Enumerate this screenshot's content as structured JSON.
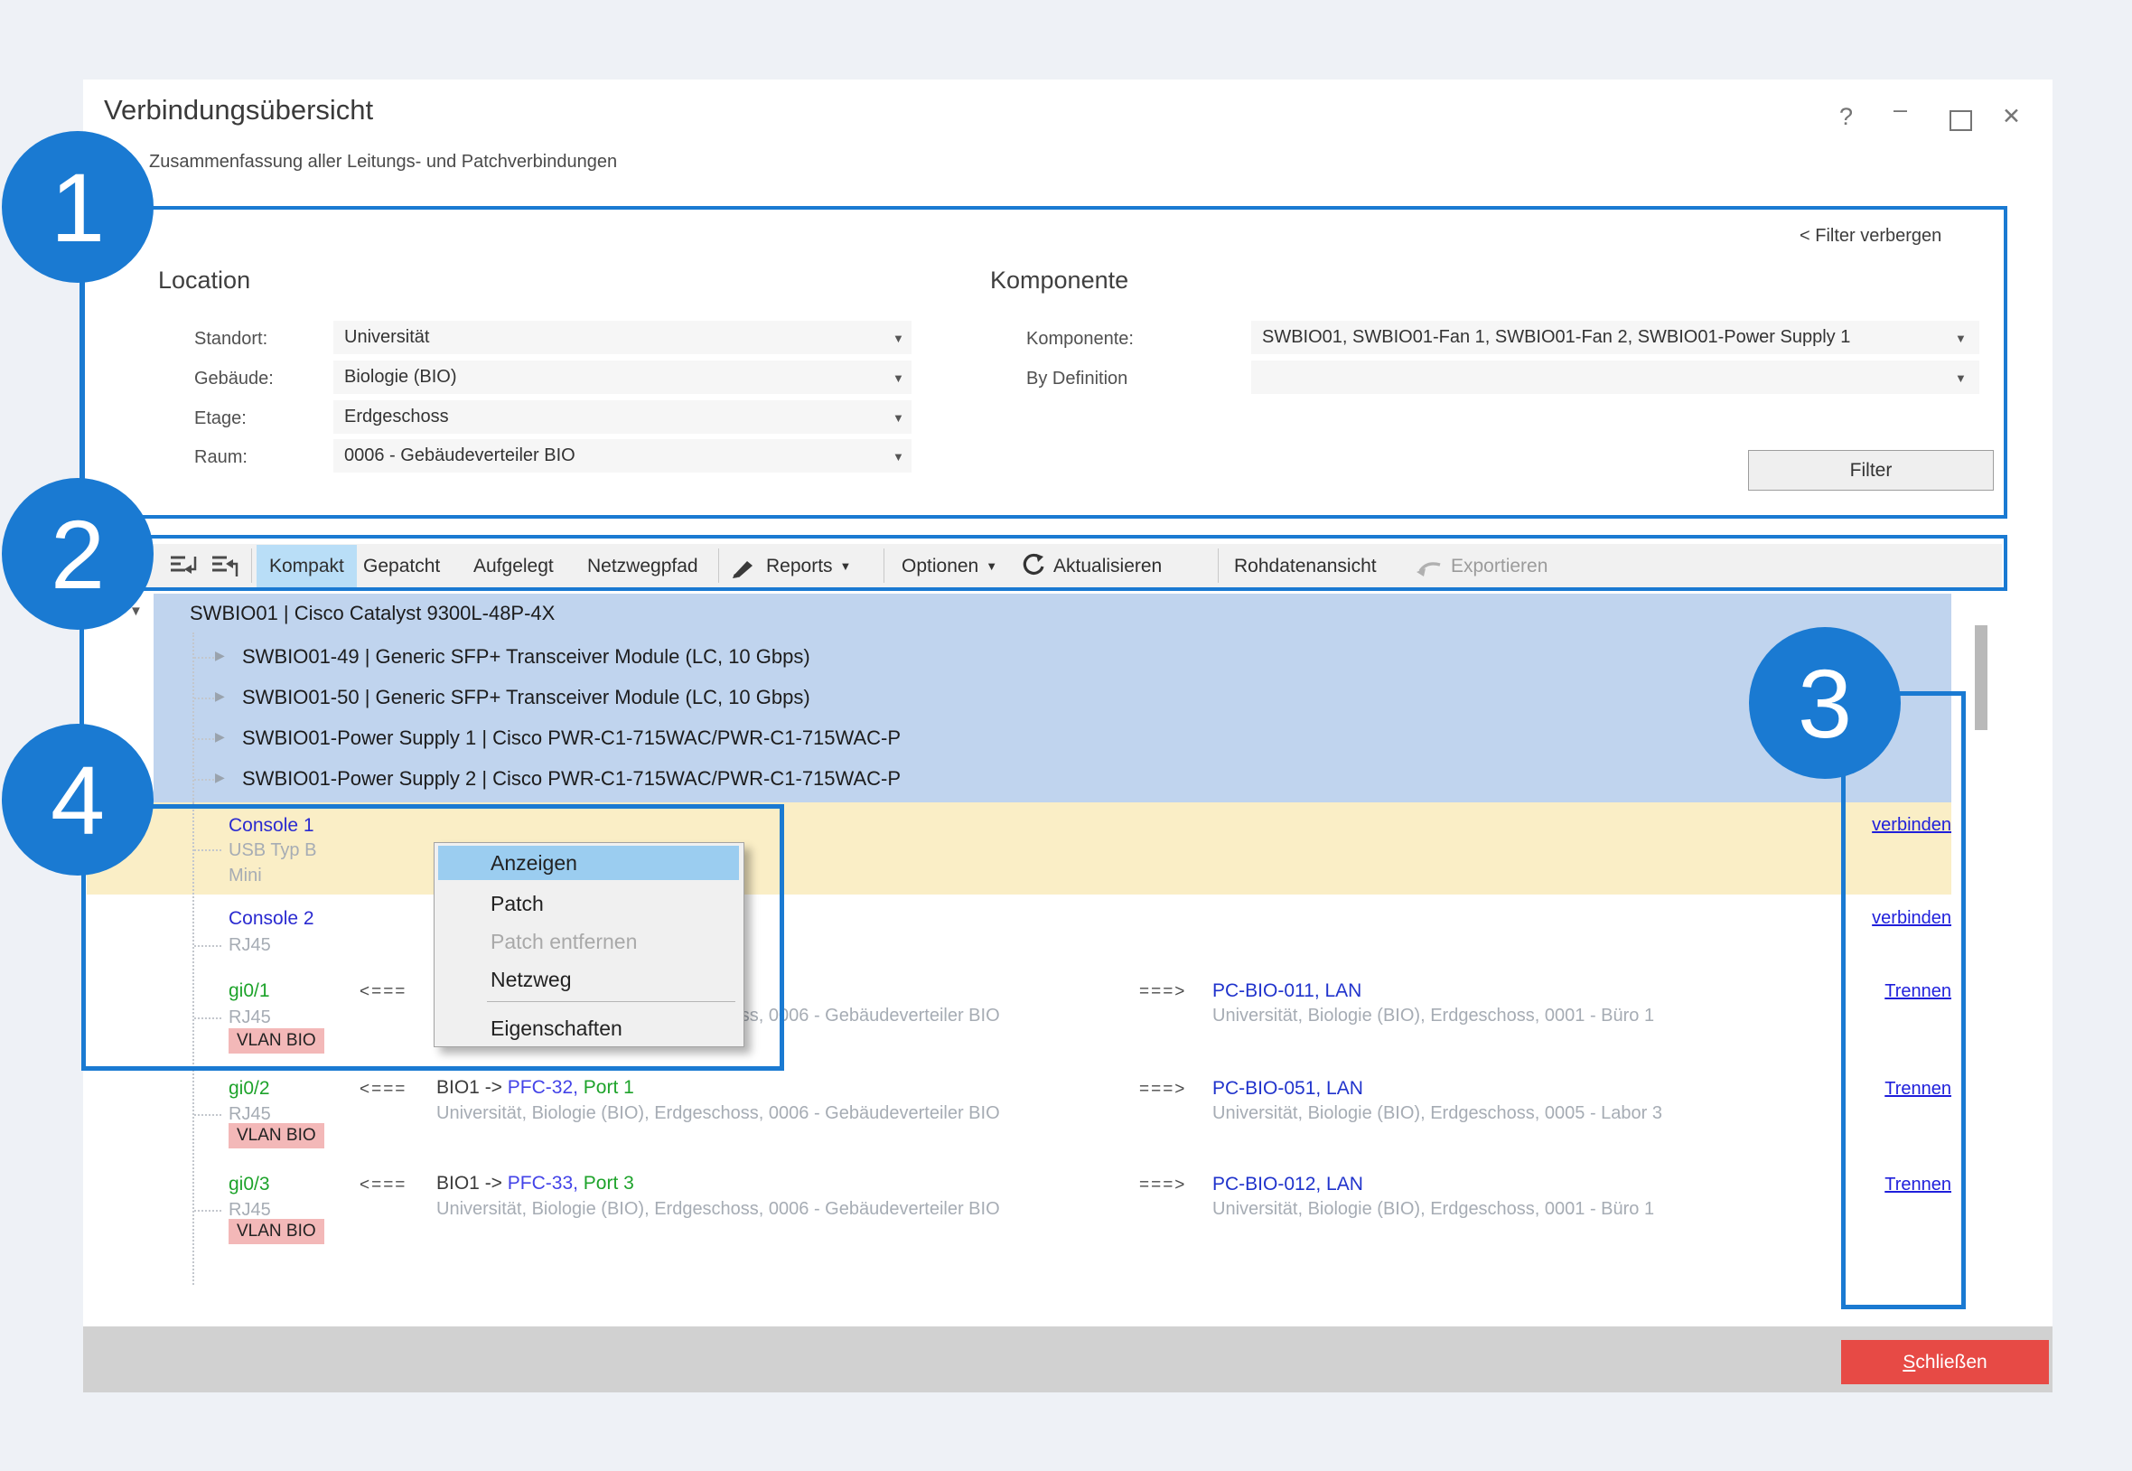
{
  "window": {
    "title": "Verbindungsübersicht",
    "subtitle": "Zusammenfassung aller Leitungs- und Patchverbindungen",
    "controls": {
      "help": "?",
      "minimize": "–",
      "close": "✕"
    }
  },
  "filter": {
    "hide_link": "< Filter verbergen",
    "location": {
      "title": "Location",
      "fields": [
        {
          "label": "Standort:",
          "value": "Universität"
        },
        {
          "label": "Gebäude:",
          "value": "Biologie (BIO)"
        },
        {
          "label": "Etage:",
          "value": "Erdgeschoss"
        },
        {
          "label": "Raum:",
          "value": "0006 - Gebäudeverteiler BIO"
        }
      ]
    },
    "component": {
      "title": "Komponente",
      "rows": [
        {
          "label": "Komponente:",
          "value": "SWBIO01, SWBIO01-Fan 1, SWBIO01-Fan 2, SWBIO01-Power Supply 1"
        },
        {
          "label": "By Definition",
          "value": ""
        }
      ]
    },
    "filter_button": "Filter"
  },
  "toolbar": {
    "views": [
      {
        "label": "Kompakt"
      },
      {
        "label": "Gepatcht"
      },
      {
        "label": "Aufgelegt"
      },
      {
        "label": "Netzwegpfad"
      }
    ],
    "active_view": "Kompakt",
    "reports": "Reports",
    "options": "Optionen",
    "refresh": "Aktualisieren",
    "raw_view": "Rohdatenansicht",
    "export": "Exportieren"
  },
  "tree": {
    "root": "SWBIO01 | Cisco Catalyst 9300L-48P-4X",
    "children": [
      {
        "label": "SWBIO01-49 | Generic SFP+ Transceiver Module (LC, 10 Gbps)"
      },
      {
        "label": "SWBIO01-50 | Generic SFP+ Transceiver Module (LC, 10 Gbps)"
      },
      {
        "label": "SWBIO01-Power Supply 1 | Cisco PWR-C1-715WAC/PWR-C1-715WAC-P"
      },
      {
        "label": "SWBIO01-Power Supply 2 | Cisco PWR-C1-715WAC/PWR-C1-715WAC-P"
      }
    ]
  },
  "ports": [
    {
      "name": "Console 1",
      "sub1": "USB Typ B",
      "sub2": "Mini",
      "action": "verbinden"
    },
    {
      "name": "Console 2",
      "sub1": "RJ45",
      "action": "verbinden"
    },
    {
      "name": "gi0/1",
      "sub1": "RJ45",
      "vlan": "VLAN BIO",
      "arrow_in": "<===",
      "loc_in": "Universität, Biologie (BIO), Erdgeschoss, 0006 - Gebäudeverteiler BIO",
      "arrow_out": "===>",
      "target": "PC-BIO-011, LAN",
      "loc_out": "Universität, Biologie (BIO), Erdgeschoss, 0001 - Büro 1",
      "action": "Trennen"
    },
    {
      "name": "gi0/2",
      "sub1": "RJ45",
      "vlan": "VLAN BIO",
      "arrow_in": "<===",
      "path_prefix": "BIO1 -> ",
      "path_device": "PFC-32,",
      "path_port": " Port 1",
      "loc_in": "Universität, Biologie (BIO), Erdgeschoss, 0006 - Gebäudeverteiler BIO",
      "arrow_out": "===>",
      "target": "PC-BIO-051, LAN",
      "loc_out": "Universität, Biologie (BIO), Erdgeschoss, 0005 - Labor 3",
      "action": "Trennen"
    },
    {
      "name": "gi0/3",
      "sub1": "RJ45",
      "vlan": "VLAN BIO",
      "arrow_in": "<===",
      "path_prefix": "BIO1 -> ",
      "path_device": "PFC-33,",
      "path_port": " Port 3",
      "loc_in": "Universität, Biologie (BIO), Erdgeschoss, 0006 - Gebäudeverteiler BIO",
      "arrow_out": "===>",
      "target": "PC-BIO-012, LAN",
      "loc_out": "Universität, Biologie (BIO), Erdgeschoss, 0001 - Büro 1",
      "action": "Trennen"
    }
  ],
  "context_menu": {
    "items": [
      {
        "label": "Anzeigen",
        "highlighted": true
      },
      {
        "label": "Patch"
      },
      {
        "label": "Patch entfernen",
        "disabled": true
      },
      {
        "label": "Netzweg"
      },
      {
        "label": "Eigenschaften"
      }
    ]
  },
  "footer": {
    "close_button": "Schließen"
  },
  "callouts": {
    "c1": "1",
    "c2": "2",
    "c3": "3",
    "c4": "4"
  },
  "colors": {
    "callout_blue": "#1a7ad2",
    "selection_blue": "#c0d4ee",
    "row_yellow": "#faeec6",
    "menu_highlight": "#9bcdf0",
    "vlan_badge": "#f3b8b8",
    "close_red": "#e74a45"
  }
}
